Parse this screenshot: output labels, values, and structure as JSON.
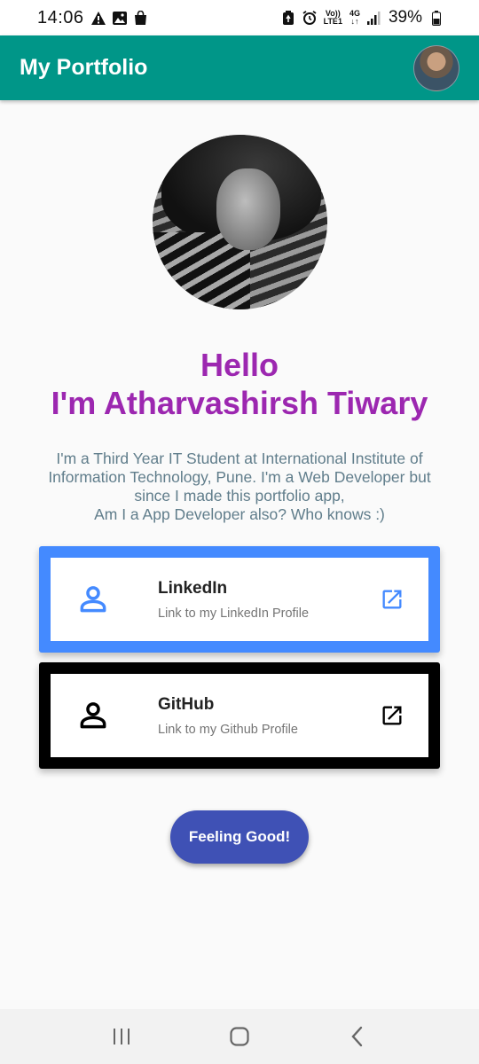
{
  "status_bar": {
    "time": "14:06",
    "network_top": "Vo))",
    "network_bottom": "LTE1",
    "network_gen": "4G",
    "battery": "39%"
  },
  "app_bar": {
    "title": "My Portfolio"
  },
  "profile": {
    "greeting_line1": "Hello",
    "greeting_line2": "I'm Atharvashirsh Tiwary",
    "bio_line1": "I'm a Third Year IT Student at International Institute of",
    "bio_line2": "Information Technology, Pune. I'm a Web Developer but",
    "bio_line3": "since I made this portfolio app,",
    "bio_line4": "Am I a App Developer also? Who knows :)"
  },
  "cards": [
    {
      "title": "LinkedIn",
      "subtitle": "Link to my LinkedIn Profile",
      "color": "#448aff",
      "icon": "person-icon",
      "action_icon": "open-in-new-icon"
    },
    {
      "title": "GitHub",
      "subtitle": "Link to my Github Profile",
      "color": "#000000",
      "icon": "person-icon",
      "action_icon": "open-in-new-icon"
    }
  ],
  "action_button": {
    "label": "Feeling Good!",
    "color": "#3f51b5"
  },
  "colors": {
    "app_bar": "#009688",
    "greeting": "#9c27b0",
    "bio": "#607d8b"
  }
}
